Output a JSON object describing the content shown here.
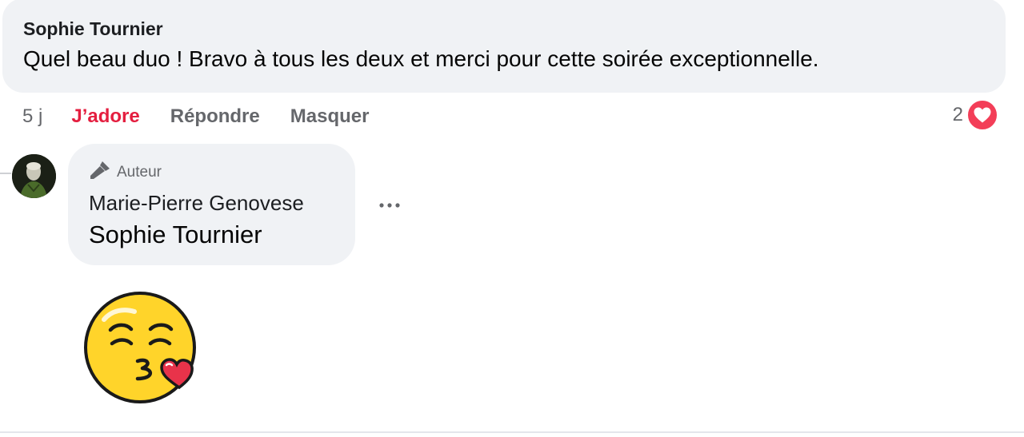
{
  "comment": {
    "author": "Sophie Tournier",
    "text": "Quel beau duo ! Bravo à tous les deux et merci pour cette soirée exceptionnelle.",
    "actions": {
      "time": "5 j",
      "like": "J’adore",
      "reply": "Répondre",
      "hide": "Masquer"
    },
    "reaction_count": "2",
    "reaction_icon": "heart-icon"
  },
  "reply": {
    "badge": "Auteur",
    "badge_icon": "microphone-icon",
    "author": "Marie-Pierre Genovese",
    "mention": "Sophie Tournier",
    "more_icon": "more-icon",
    "sticker": "kiss-emoji-sticker"
  },
  "colors": {
    "bubble": "#f0f2f5",
    "like_active": "#e41e3f",
    "heart_badge": "#f33e58",
    "secondary_text": "#65676b"
  }
}
